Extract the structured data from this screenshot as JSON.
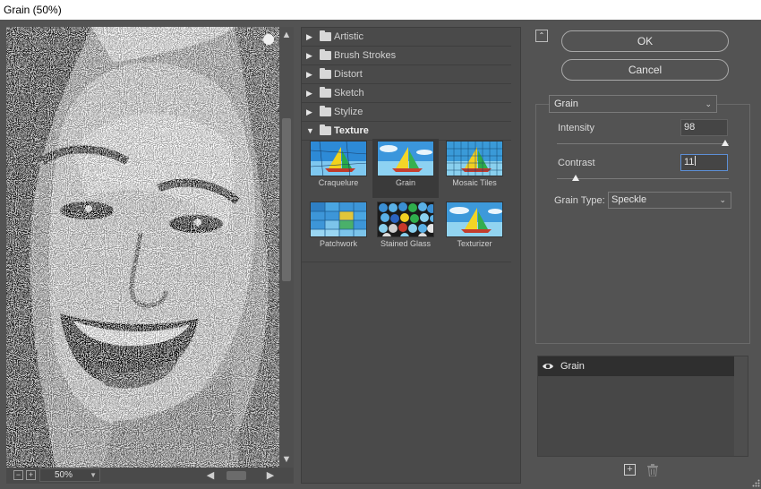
{
  "window": {
    "title": "Grain (50%)"
  },
  "preview": {
    "zoom_out_symbol": "−",
    "zoom_in_symbol": "+",
    "zoom_value": "50%",
    "scroll_up": "▲",
    "scroll_down": "▼",
    "scroll_left": "◀",
    "scroll_right": "▶"
  },
  "gallery": {
    "categories": [
      {
        "label": "Artistic",
        "expanded": false
      },
      {
        "label": "Brush Strokes",
        "expanded": false
      },
      {
        "label": "Distort",
        "expanded": false
      },
      {
        "label": "Sketch",
        "expanded": false
      },
      {
        "label": "Stylize",
        "expanded": false
      },
      {
        "label": "Texture",
        "expanded": true
      }
    ],
    "texture_filters": [
      {
        "label": "Craquelure",
        "selected": false
      },
      {
        "label": "Grain",
        "selected": true
      },
      {
        "label": "Mosaic Tiles",
        "selected": false
      },
      {
        "label": "Patchwork",
        "selected": false
      },
      {
        "label": "Stained Glass",
        "selected": false
      },
      {
        "label": "Texturizer",
        "selected": false
      }
    ]
  },
  "actions": {
    "ok_label": "OK",
    "cancel_label": "Cancel"
  },
  "settings": {
    "filter_select": "Grain",
    "intensity_label": "Intensity",
    "intensity_value": "98",
    "intensity_fraction": 0.98,
    "contrast_label": "Contrast",
    "contrast_value": "11",
    "contrast_fraction": 0.11,
    "grain_type_label": "Grain Type:",
    "grain_type_value": "Speckle"
  },
  "effect_layers": {
    "items": [
      {
        "label": "Grain",
        "visible": true
      }
    ]
  },
  "colors": {
    "panel": "#535353",
    "focus_border": "#5d8fd6",
    "selected_row": "#2f2f2f"
  },
  "icons": {
    "collapse": "collapse-arrows-icon",
    "expand": "triangle-right-icon",
    "expanded": "triangle-down-icon",
    "folder": "folder-icon",
    "visibility": "eye-icon",
    "new_layer": "new-layer-icon",
    "delete": "trash-icon",
    "dropdown": "chevron-down-icon"
  }
}
